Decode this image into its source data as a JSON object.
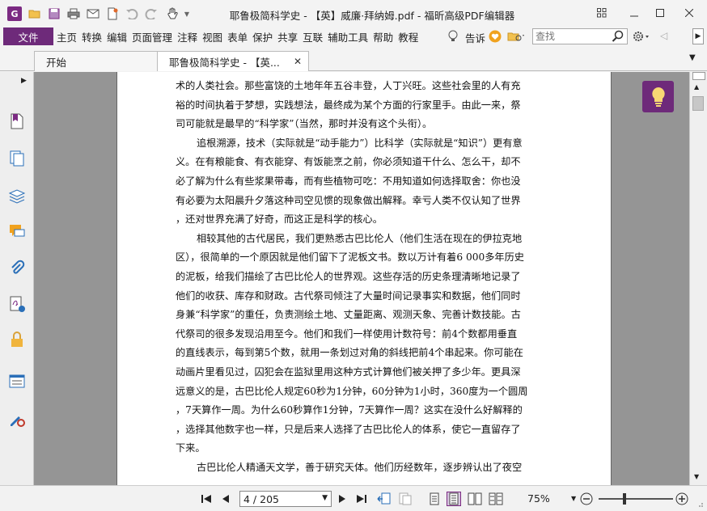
{
  "window": {
    "title": "耶鲁极简科学史 - 【英】威廉·拜纳姆.pdf - 福昕高级PDF编辑器",
    "logo_letter": "G"
  },
  "menu": {
    "file": "文件",
    "items": [
      "主页",
      "转换",
      "编辑",
      "页面管理",
      "注释",
      "视图",
      "表单",
      "保护",
      "共享",
      "互联",
      "辅助工具",
      "帮助",
      "教程"
    ],
    "tell_me": "告诉",
    "search_placeholder": "查找"
  },
  "tabs": [
    {
      "label": "开始"
    },
    {
      "label": "耶鲁极简科学史 - 【英..."
    }
  ],
  "document": {
    "lines": [
      {
        "text": "术的人类社会。那些富饶的土地年年五谷丰登，人丁兴旺。这些社会里的人有充",
        "indent": false
      },
      {
        "text": "裕的时间执着于梦想，实践想法，最终成为某个方面的行家里手。由此一来，祭",
        "indent": false
      },
      {
        "text": "司可能就是最早的“科学家”（当然，那时并没有这个头衔）。",
        "indent": false
      },
      {
        "text": "追根溯源，技术（实际就是“动手能力”）比科学（实际就是“知识”）更有意",
        "indent": true
      },
      {
        "text": "义。在有粮能食、有衣能穿、有饭能烹之前，你必须知道干什么、怎么干，却不",
        "indent": false
      },
      {
        "text": "必了解为什么有些浆果带毒，而有些植物可吃：不用知道如何选择取舍：你也没",
        "indent": false
      },
      {
        "text": "有必要为太阳晨升夕落这种司空见惯的现象做出解释。幸亏人类不仅认知了世界",
        "indent": false
      },
      {
        "text": "，还对世界充满了好奇，而这正是科学的核心。",
        "indent": false
      },
      {
        "text": "相较其他的古代居民，我们更熟悉古巴比伦人（他们生活在现在的伊拉克地",
        "indent": true
      },
      {
        "text": "区），很简单的一个原因就是他们留下了泥板文书。数以万计有着6 000多年历史",
        "indent": false
      },
      {
        "text": "的泥板，给我们描绘了古巴比伦人的世界观。这些存活的历史条理清晰地记录了",
        "indent": false
      },
      {
        "text": "他们的收获、库存和财政。古代祭司倾注了大量时间记录事实和数据，他们同时",
        "indent": false
      },
      {
        "text": "身兼“科学家”的重任，负责测绘土地、丈量距离、观测天象、完善计数技能。古",
        "indent": false
      },
      {
        "text": "代祭司的很多发现沿用至今。他们和我们一样使用计数符号：前4个数都用垂直",
        "indent": false
      },
      {
        "text": "的直线表示，每到第5个数，就用一条划过对角的斜线把前4个串起来。你可能在",
        "indent": false
      },
      {
        "text": "动画片里看见过，囚犯会在监狱里用这种方式计算他们被关押了多少年。更具深",
        "indent": false
      },
      {
        "text": "远意义的是，古巴比伦人规定60秒为1分钟，60分钟为1小时，360度为一个圆周",
        "indent": false
      },
      {
        "text": "，7天算作一周。为什么60秒算作1分钟，7天算作一周？这实在没什么好解释的",
        "indent": false
      },
      {
        "text": "，选择其他数字也一样，只是后来人选择了古巴比伦人的体系，使它一直留存了",
        "indent": false
      },
      {
        "text": "下来。",
        "indent": false
      },
      {
        "text": "古巴比伦人精通天文学，善于研究天体。他们历经数年，逐步辨认出了夜空",
        "indent": true
      }
    ]
  },
  "status": {
    "page_value": "4 / 205",
    "zoom": "75%",
    "zoom_level_fraction": 0.35
  },
  "colors": {
    "accent": "#6e2a7a",
    "viewer_bg": "#959595"
  },
  "icons": [
    "foxit-logo-icon",
    "open-folder-icon",
    "save-icon",
    "print-icon",
    "undo-icon",
    "redo-icon",
    "hand-tool-icon",
    "lightbulb-icon",
    "search-icon",
    "settings-icon",
    "bookmark-icon",
    "pages-icon",
    "layers-icon",
    "comments-icon",
    "attachment-icon",
    "signature-icon",
    "lock-icon",
    "form-icon",
    "certify-icon"
  ]
}
